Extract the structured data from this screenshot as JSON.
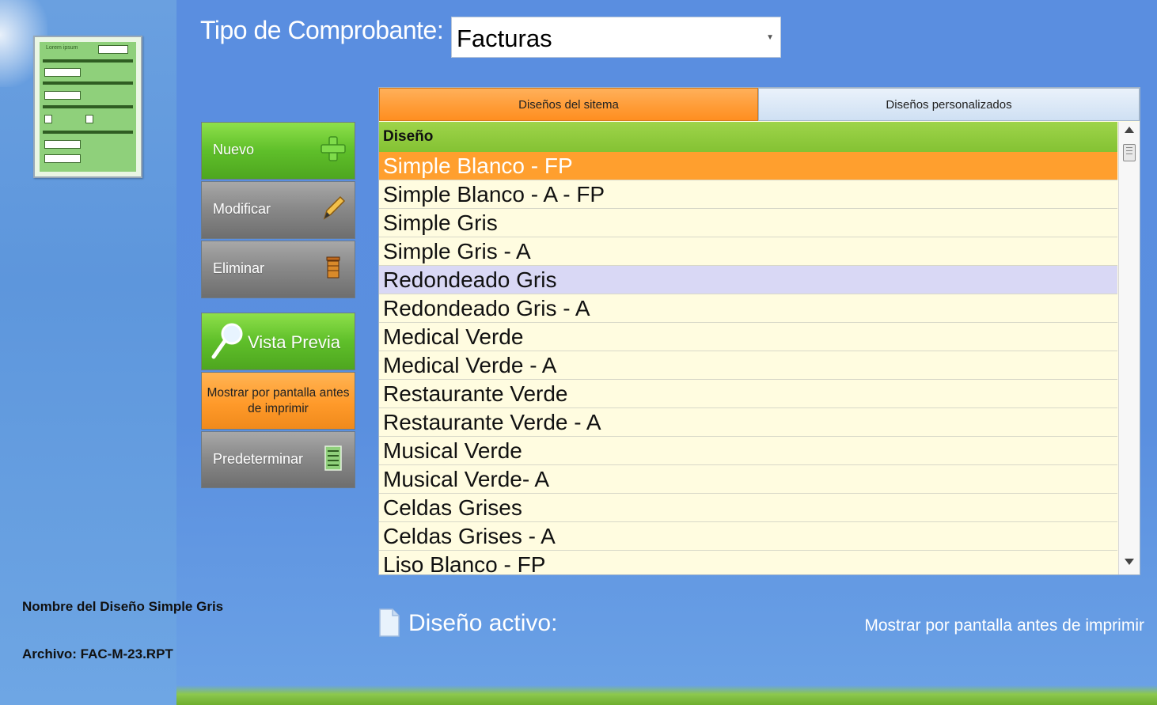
{
  "header": {
    "type_label": "Tipo de Comprobante:",
    "type_value": "Facturas"
  },
  "thumbnail": {
    "title": "Lorem ipsum"
  },
  "buttons": {
    "nuevo": "Nuevo",
    "modificar": "Modificar",
    "eliminar": "Eliminar",
    "vista_previa": "Vista Previa",
    "mostrar": "Mostrar por pantalla antes de imprimir",
    "predeterminar": "Predeterminar"
  },
  "tabs": [
    {
      "label": "Diseños del sitema",
      "active": true
    },
    {
      "label": "Diseños personalizados",
      "active": false
    }
  ],
  "grid": {
    "column_header": "Diseño",
    "rows": [
      "Simple Blanco - FP",
      "Simple Blanco - A - FP",
      "Simple Gris",
      "Simple Gris - A",
      "Redondeado Gris",
      "Redondeado Gris - A",
      "Medical Verde",
      "Medical Verde - A",
      "Restaurante Verde",
      "Restaurante Verde - A",
      "Musical Verde",
      "Musical Verde- A",
      "Celdas Grises",
      "Celdas Grises - A",
      "Liso Blanco - FP"
    ],
    "selected_index": 0,
    "hover_index": 4
  },
  "info": {
    "design_name": "Nombre del Diseño Simple Gris",
    "file": "Archivo: FAC-M-23.RPT"
  },
  "status": {
    "active_label": "Diseño activo:",
    "right_note": "Mostrar por pantalla antes de imprimir"
  },
  "colors": {
    "accent_orange": "#ff9f2e",
    "accent_green": "#84c233",
    "background_blue": "#5a8ee0"
  }
}
